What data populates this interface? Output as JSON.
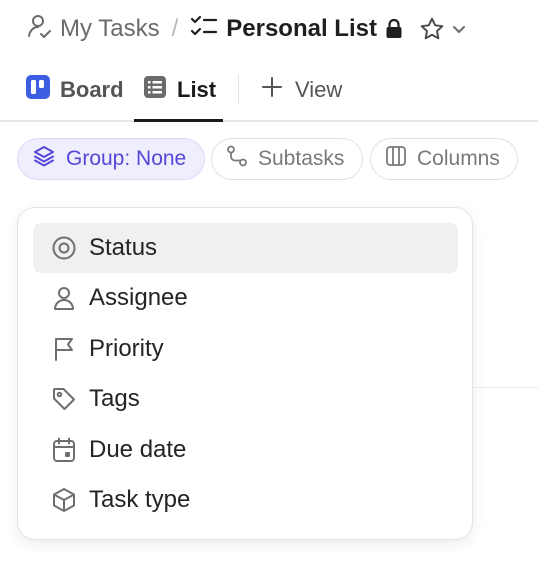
{
  "breadcrumb": {
    "parent": "My Tasks",
    "separator": "/",
    "current": "Personal List"
  },
  "tabs": [
    {
      "label": "Board",
      "icon": "board-icon"
    },
    {
      "label": "List",
      "icon": "list-icon",
      "active": true
    },
    {
      "label": "View",
      "icon": "plus-icon"
    }
  ],
  "toolbar": {
    "group_label": "Group: None",
    "subtasks_label": "Subtasks",
    "columns_label": "Columns"
  },
  "group_menu": {
    "items": [
      {
        "label": "Status",
        "icon": "status-icon",
        "highlighted": true
      },
      {
        "label": "Assignee",
        "icon": "person-icon"
      },
      {
        "label": "Priority",
        "icon": "flag-icon"
      },
      {
        "label": "Tags",
        "icon": "tag-icon"
      },
      {
        "label": "Due date",
        "icon": "calendar-icon"
      },
      {
        "label": "Task type",
        "icon": "cube-icon"
      }
    ]
  },
  "colors": {
    "accent": "#5746d6",
    "accent_bg": "#efeefd",
    "board_icon": "#3d5ee1"
  }
}
